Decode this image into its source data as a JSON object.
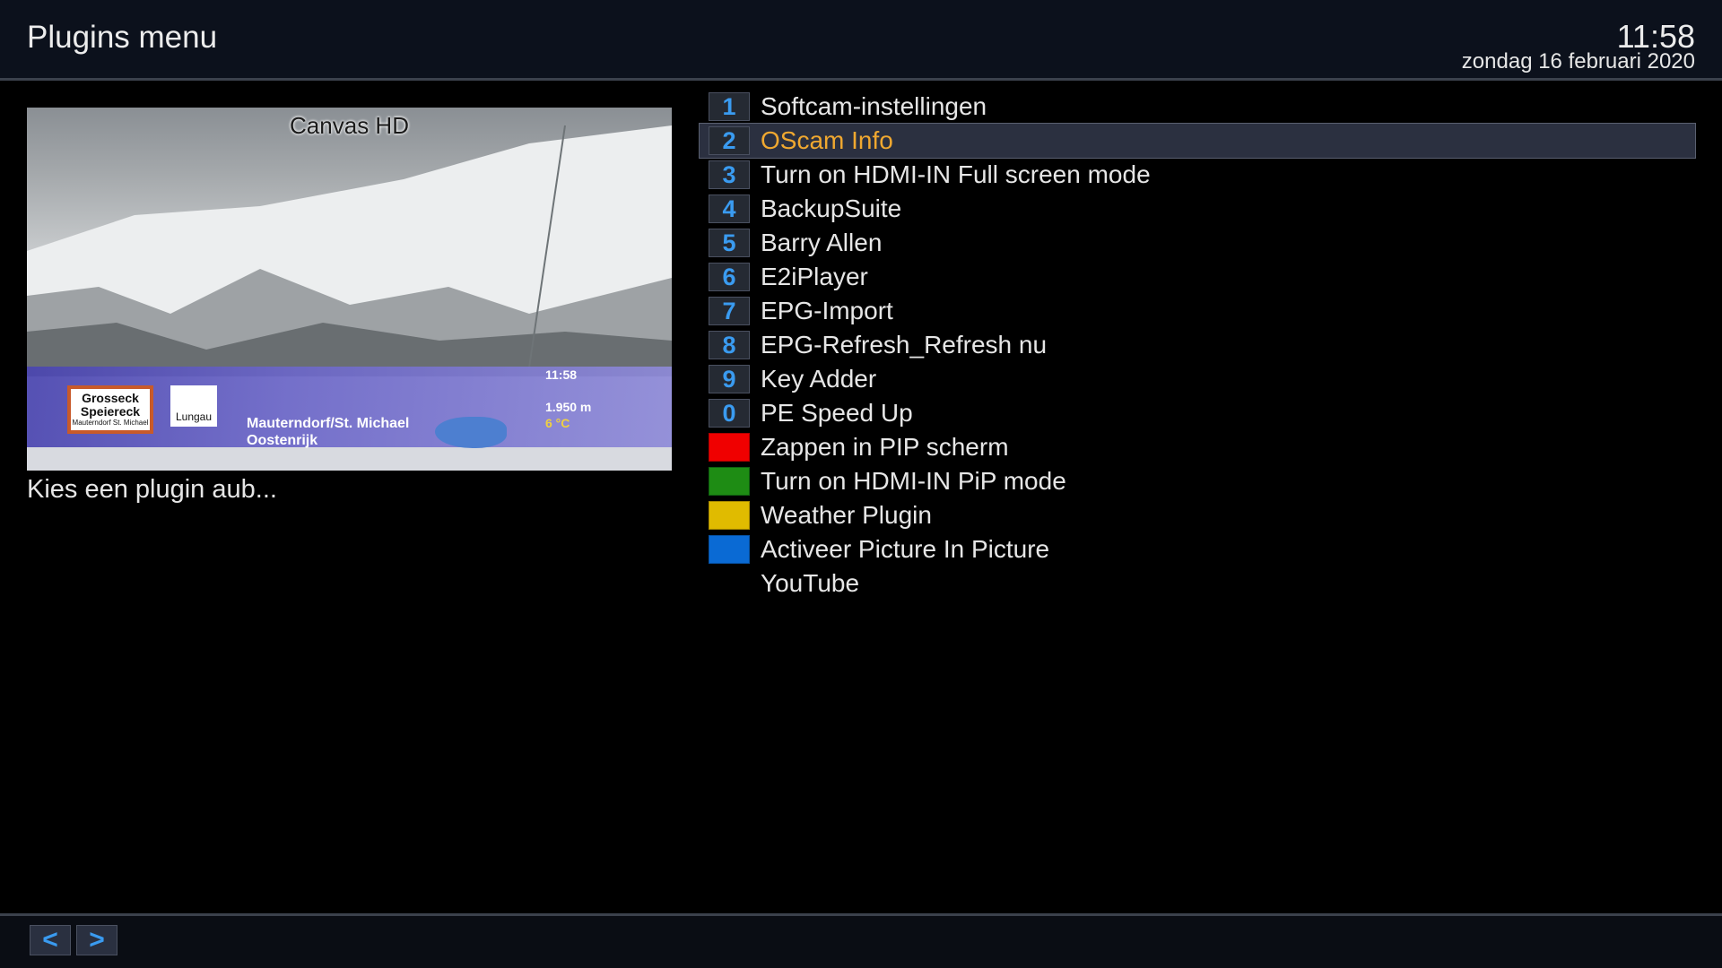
{
  "header": {
    "title": "Plugins menu",
    "time": "11:58",
    "date": "zondag 16 februari 2020"
  },
  "preview": {
    "channel": "Canvas HD",
    "logo1_title": "Grosseck Speiereck",
    "logo1_sub": "Mauterndorf St. Michael",
    "logo2": "Lungau",
    "ticker_time": "11:58",
    "altitude": "1.950 m",
    "temperature": "6 °C",
    "place_line1": "Mauterndorf/St. Michael",
    "place_line2": "Oostenrijk"
  },
  "hint": "Kies een plugin aub...",
  "plugins": [
    {
      "key": "1",
      "label": "Softcam-instellingen"
    },
    {
      "key": "2",
      "label": "OScam Info",
      "selected": true
    },
    {
      "key": "3",
      "label": "Turn on HDMI-IN Full screen mode"
    },
    {
      "key": "4",
      "label": "BackupSuite"
    },
    {
      "key": "5",
      "label": "Barry Allen"
    },
    {
      "key": "6",
      "label": "E2iPlayer"
    },
    {
      "key": "7",
      "label": "EPG-Import"
    },
    {
      "key": "8",
      "label": "EPG-Refresh_Refresh nu"
    },
    {
      "key": "9",
      "label": "Key Adder"
    },
    {
      "key": "0",
      "label": "PE Speed Up"
    },
    {
      "key": "",
      "color": "red",
      "label": "Zappen in PIP scherm"
    },
    {
      "key": "",
      "color": "green",
      "label": "Turn on HDMI-IN PiP mode"
    },
    {
      "key": "",
      "color": "yellow",
      "label": "Weather Plugin"
    },
    {
      "key": "",
      "color": "blue",
      "label": "Activeer Picture In Picture"
    },
    {
      "key": "",
      "label": "YouTube"
    }
  ],
  "footer": {
    "prev": "<",
    "next": ">"
  },
  "colors": {
    "accent_blue": "#3a9bf0",
    "selected_text": "#f0a830",
    "red": "#f00000",
    "green": "#1e8c14",
    "yellow": "#e0bb00",
    "blue": "#0a6ad4"
  }
}
